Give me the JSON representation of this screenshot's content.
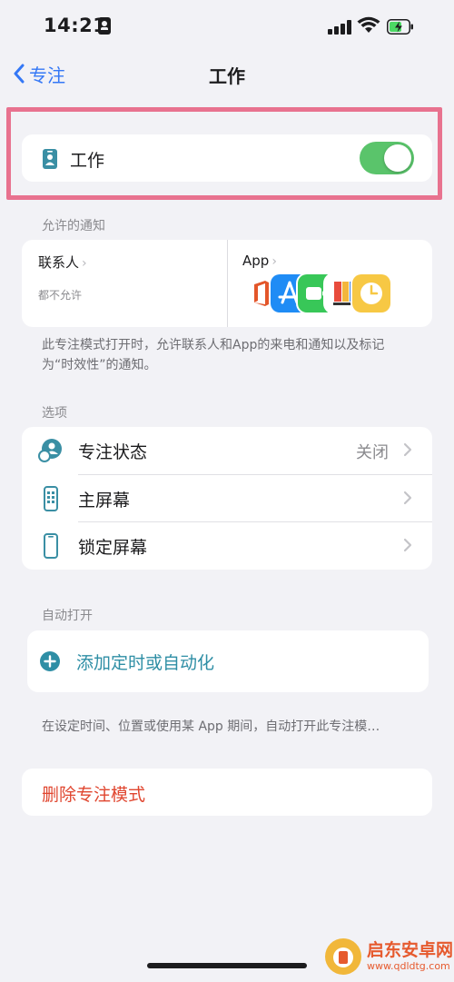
{
  "status_bar": {
    "time": "14:21"
  },
  "nav": {
    "back_label": "专注",
    "title": "工作"
  },
  "focus": {
    "label": "工作",
    "enabled": true
  },
  "allowed_notifications": {
    "header": "允许的通知",
    "contacts_label": "联系人",
    "contacts_value": "都不允许",
    "apps_label": "App",
    "apps": [
      "office-app-icon",
      "app-store-icon",
      "facetime-icon",
      "books-app-icon",
      "clock-app-icon"
    ],
    "note": "此专注模式打开时，允许联系人和App的来电和通知以及标记为“时效性”的通知。"
  },
  "options": {
    "header": "选项",
    "items": [
      {
        "label": "专注状态",
        "value": "关闭"
      },
      {
        "label": "主屏幕",
        "value": ""
      },
      {
        "label": "锁定屏幕",
        "value": ""
      }
    ]
  },
  "auto_on": {
    "header": "自动打开",
    "add_label": "添加定时或自动化",
    "note": "在设定时间、位置或使用某 App 期间，自动打开此专注模…"
  },
  "delete": {
    "label": "删除专注模式"
  },
  "watermark": {
    "name": "启东安卓网",
    "url": "www.qdldtg.com"
  },
  "colors": {
    "accent": "#3478f6",
    "toggle_on": "#5ac46b",
    "destructive": "#e0462f",
    "add_action": "#2e8ea5",
    "highlight_frame": "#e8728f"
  }
}
